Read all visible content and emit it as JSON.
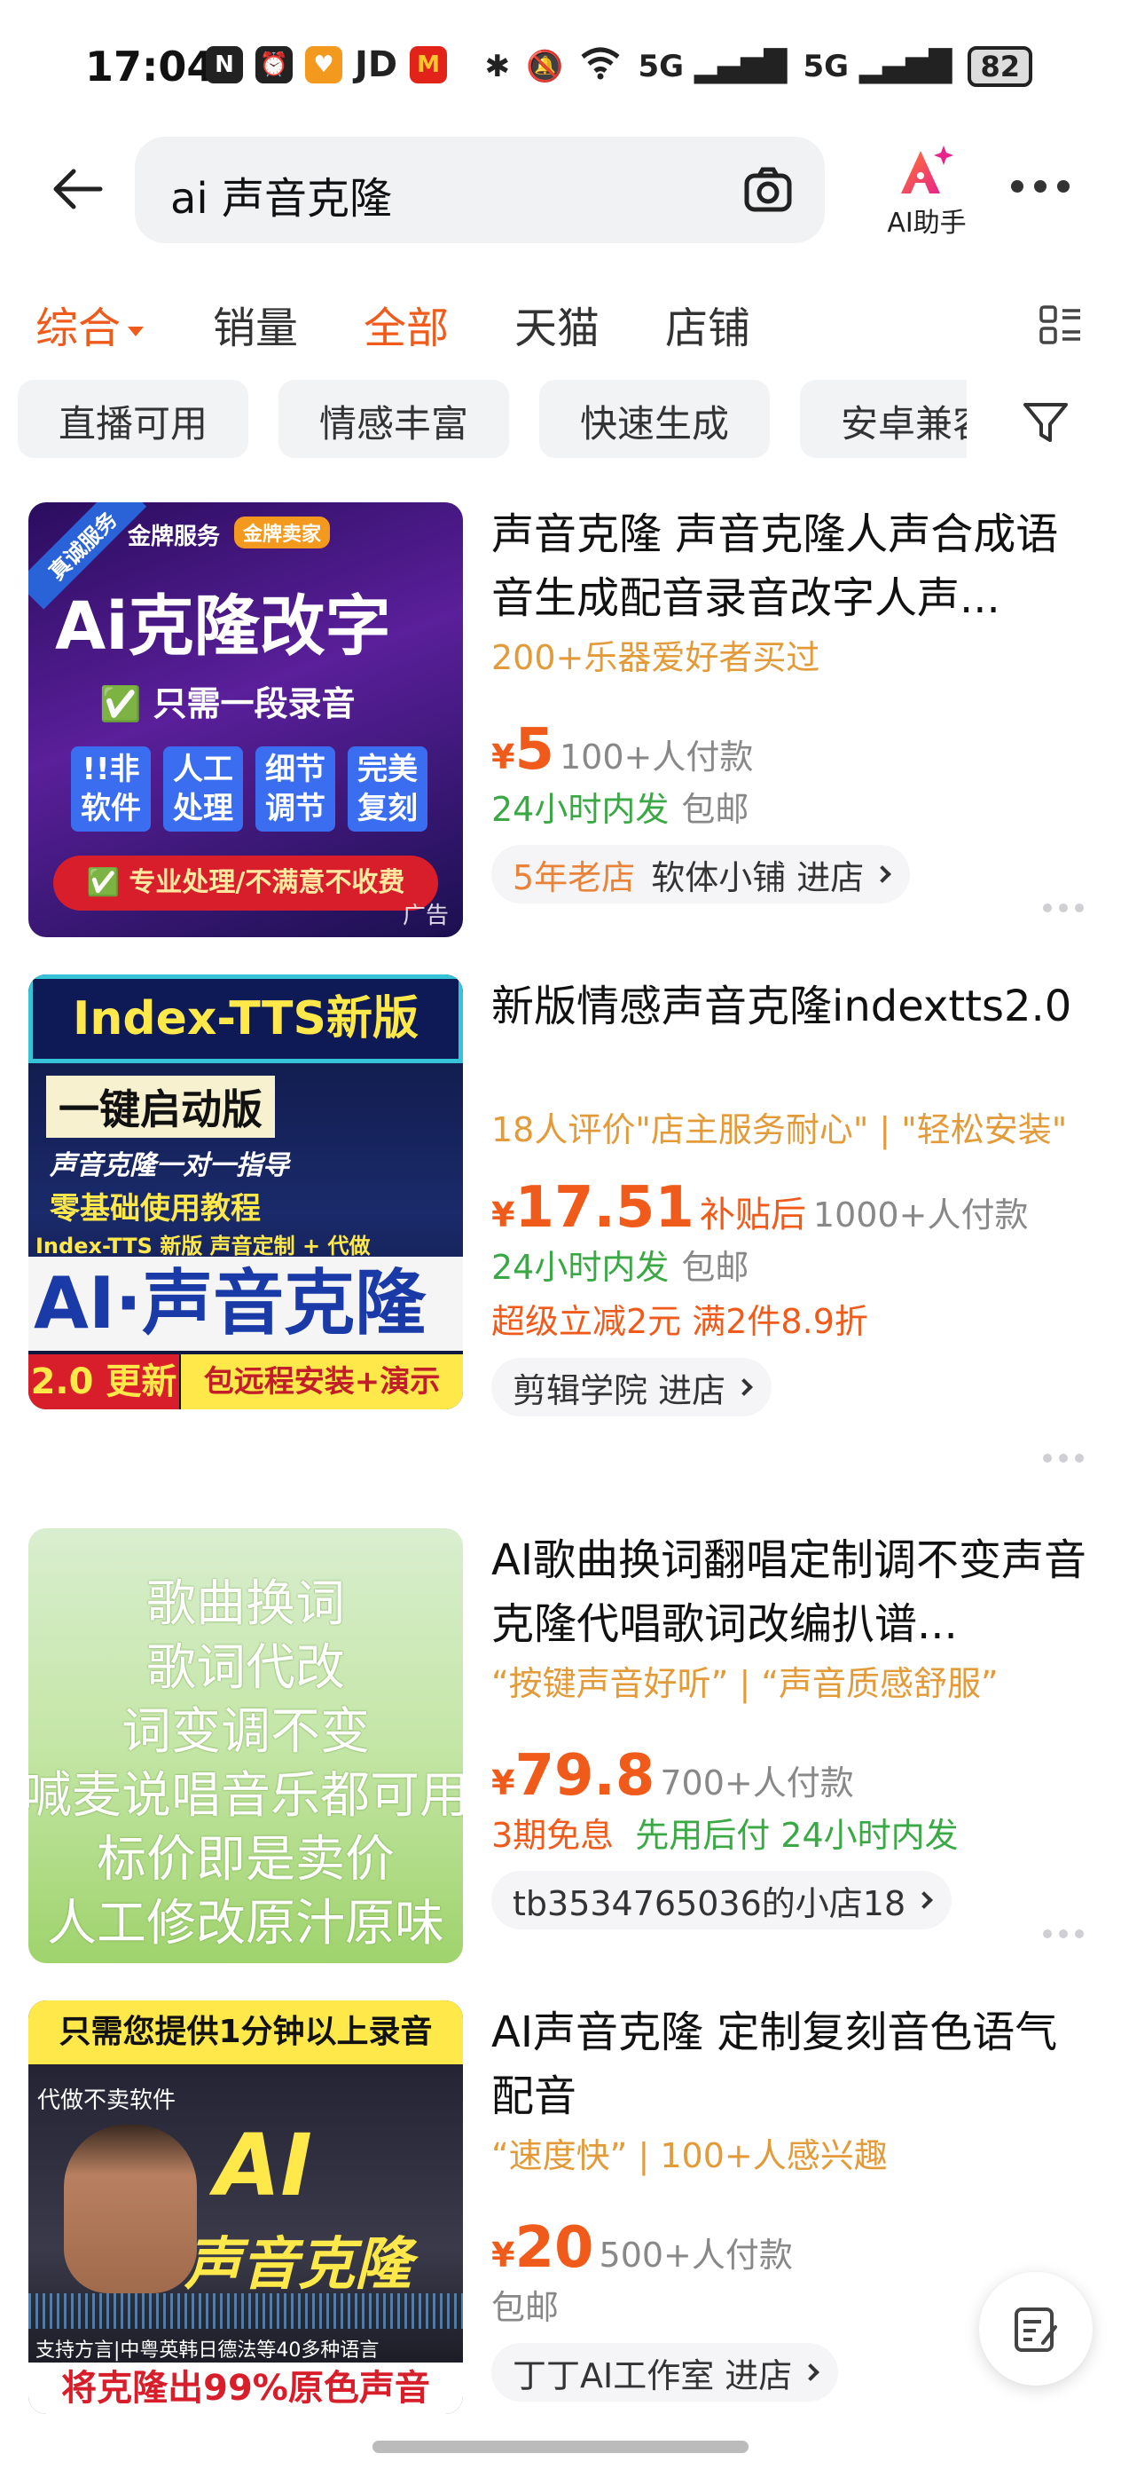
{
  "status_bar": {
    "time": "17:04",
    "battery": "82",
    "app_icons": [
      "N",
      "JD"
    ],
    "network": "5G"
  },
  "header": {
    "search_query": "ai 声音克隆",
    "ai_helper_label": "AI助手"
  },
  "sort_tabs": [
    {
      "label": "综合",
      "active": true
    },
    {
      "label": "销量",
      "active": false
    },
    {
      "label": "全部",
      "active": true
    },
    {
      "label": "天猫",
      "active": false
    },
    {
      "label": "店铺",
      "active": false
    }
  ],
  "filter_chips": [
    "直播可用",
    "情感丰富",
    "快速生成",
    "安卓兼容"
  ],
  "products": [
    {
      "title": "声音克隆 声音克隆人声合成语音生成配音录音改字人声...",
      "note": "200+乐器爱好者买过",
      "yen": "¥",
      "price": "5",
      "paid": "100+人付款",
      "ship_green": "24小时内发",
      "ship_grey": "包邮",
      "store_badge": "5年老店",
      "store": "软体小铺 进店",
      "thumb": {
        "corner": "真诚服务",
        "service": "金牌服务",
        "seller": "金牌卖家",
        "headline": "Ai克隆改字",
        "line2": "✅ 只需一段录音",
        "boxes": [
          "!!非软件",
          "人工处理",
          "细节调节",
          "完美复刻"
        ],
        "footer": "✅ 专业处理/不满意不收费",
        "ad": "广告"
      }
    },
    {
      "title": "新版情感声音克隆indextts2.0",
      "note": "18人评价\"店主服务耐心\" | \"轻松安装\"",
      "yen": "¥",
      "price": "17.51",
      "subsidy": "补贴后",
      "paid": "1000+人付款",
      "ship_green": "24小时内发",
      "ship_grey": "包邮",
      "promo": "超级立减2元  满2件8.9折",
      "store": "剪辑学院 进店",
      "thumb": {
        "top": "Index-TTS新版",
        "line1": "一键启动版",
        "line2": "声音克隆一对一指导",
        "line3": "零基础使用教程",
        "line4": "Index-TTS 新版  声音定制 + 代做",
        "headline": "AI·声音克隆",
        "badge": "2.0 更新",
        "footer": "包远程安装+演示"
      }
    },
    {
      "title": "AI歌曲换词翻唱定制调不变声音克隆代唱歌词改编扒谱...",
      "note": "“按键声音好听” | “声音质感舒服”",
      "yen": "¥",
      "price": "79.8",
      "paid": "700+人付款",
      "ship_orange": "3期免息",
      "ship_green": "先用后付  24小时内发",
      "store": "tb3534765036的小店18",
      "thumb": {
        "lines": [
          "歌曲换词",
          "歌词代改",
          "词变调不变",
          "喊麦说唱音乐都可用",
          "标价即是卖价",
          "人工修改原汁原味"
        ]
      }
    },
    {
      "title": "AI声音克隆 定制复刻音色语气配音",
      "note": "“速度快” | 100+人感兴趣",
      "yen": "¥",
      "price": "20",
      "paid": "500+人付款",
      "ship_grey": "包邮",
      "store": "丁丁AI工作室 进店",
      "thumb": {
        "top": "只需您提供1分钟以上录音",
        "tag": "代做不卖软件",
        "headline1": "AI",
        "headline2": "声音克隆",
        "langs": "支持方言|中粤英韩日德法等40多种语言",
        "footer": "将克隆出99%原色声音"
      }
    }
  ],
  "colors": {
    "accent": "#f05a1a",
    "note": "#e39b3a",
    "green": "#3aa845"
  }
}
